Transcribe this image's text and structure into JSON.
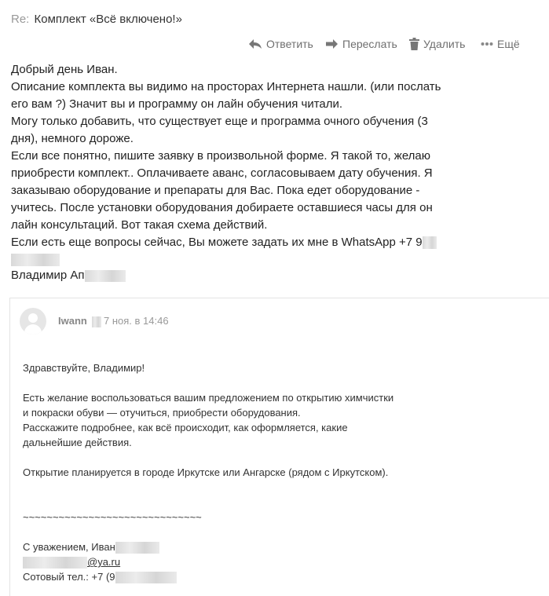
{
  "subject": {
    "prefix": "Re:",
    "title": "Комплект «Всё включено!»"
  },
  "actions": {
    "reply": "Ответить",
    "forward": "Переслать",
    "delete": "Удалить",
    "more": "Ещё"
  },
  "message": {
    "lines": [
      "Добрый день Иван.",
      "Описание комплекта вы видимо на просторах Интернета нашли. (или послать",
      "его вам ?) Значит вы и программу он лайн обучения читали.",
      "Могу только добавить, что существует еще и программа очного обучения (3",
      "дня), немного дороже.",
      "Если все понятно, пишите заявку в произвольной форме. Я такой то, желаю",
      "приобрести комплект.. Оплачиваете аванс, согласовываем дату обучения. Я",
      "заказываю оборудование и препараты для Вас. Пока едет оборудование -",
      "учитесь. После установки оборудования добираете оставшиеся часы для он",
      "лайн консультаций. Вот такая схема действий.",
      "Если есть еще вопросы сейчас, Вы можете задать их мне в  WhatsApp +7 9"
    ],
    "signature": "Владимир Ап"
  },
  "quoted": {
    "sender": "Iwann",
    "date": "7 ноя. в 14:46",
    "greeting": "Здравствуйте, Владимир!",
    "paragraph1": [
      "Есть желание воспользоваться вашим предложением по открытию химчистки",
      "и покраски обуви — отучиться, приобрести оборудования.",
      "Расскажите подробнее, как всё происходит, как оформляется, какие",
      "дальнейшие действия."
    ],
    "paragraph2": "Открытие планируется в городе Иркутске или Ангарске (рядом с Иркутском).",
    "separator": "~~~~~~~~~~~~~~~~~~~~~~~~~~~~~~",
    "regards": "С уважением, Иван",
    "email_domain": "@ya.ru",
    "phone": "Сотовый тел.: +7 (9"
  }
}
